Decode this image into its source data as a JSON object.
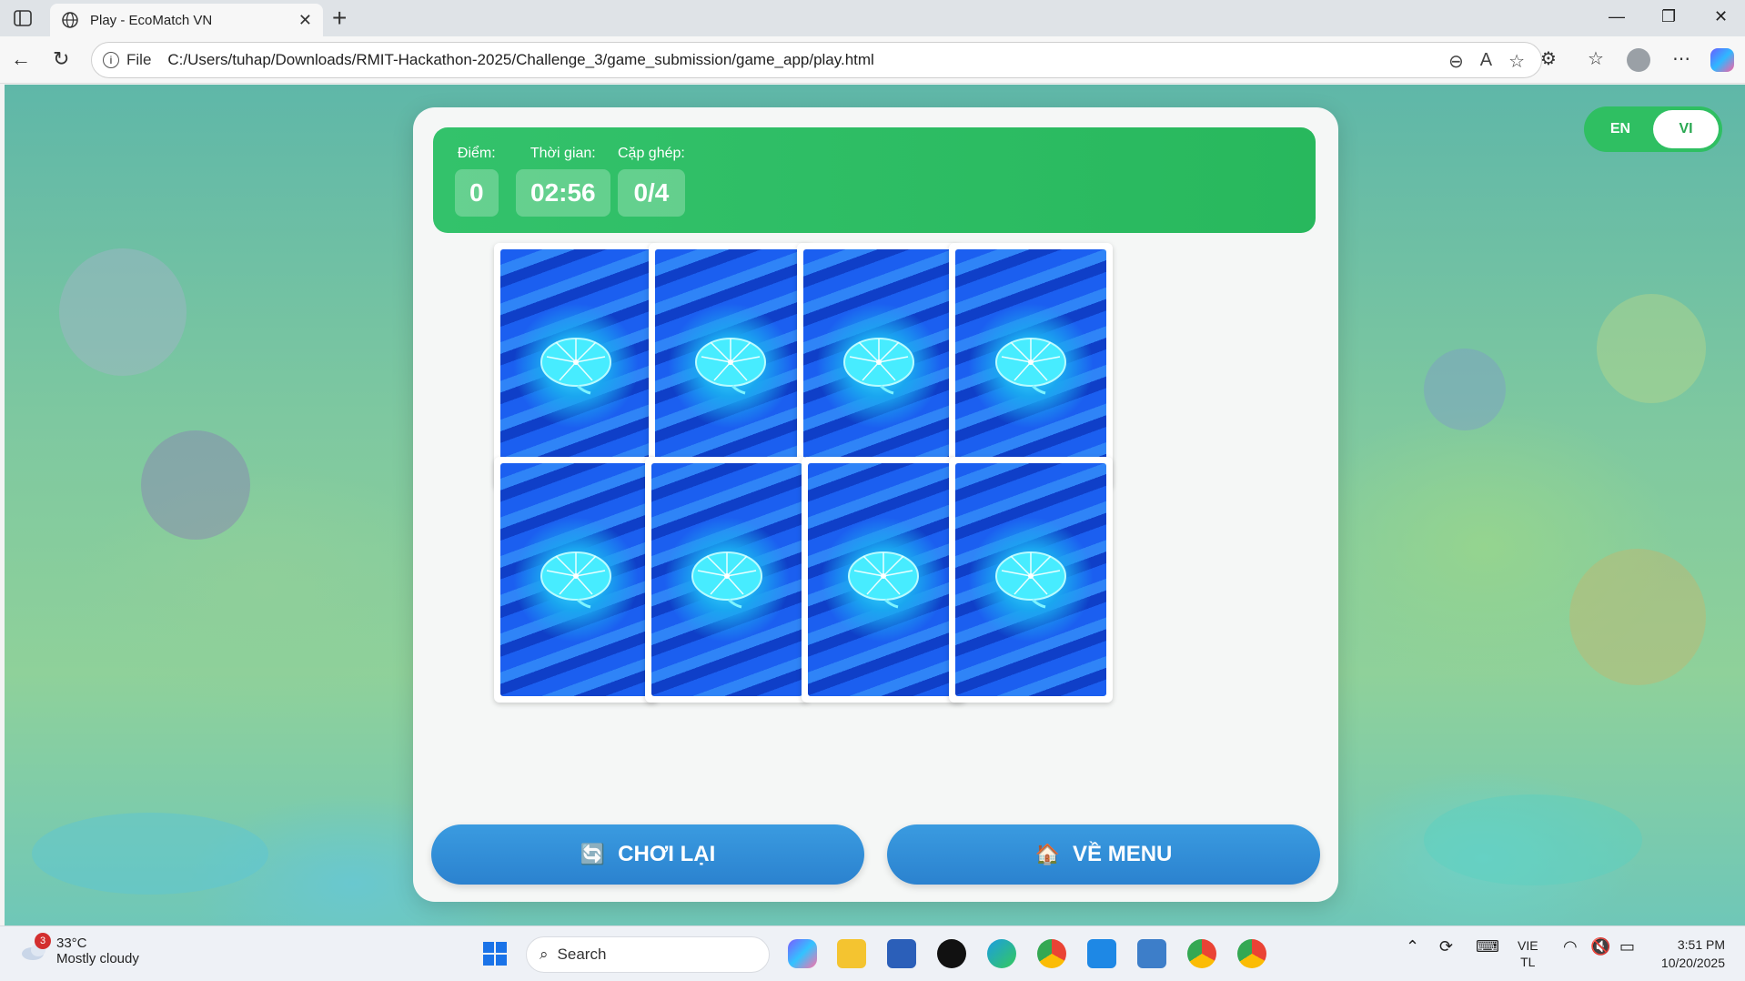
{
  "browser": {
    "tab_title": "Play - EcoMatch VN",
    "url_prefix": "File",
    "url": "C:/Users/tuhap/Downloads/RMIT-Hackathon-2025/Challenge_3/game_submission/game_app/play.html"
  },
  "lang": {
    "en": "EN",
    "vi": "VI",
    "active": "VI"
  },
  "stats": {
    "score_label": "Điểm:",
    "score_value": "0",
    "time_label": "Thời gian:",
    "time_value": "02:56",
    "pairs_label": "Cặp ghép:",
    "pairs_value": "0/4"
  },
  "cards": {
    "count": 8,
    "state": "face-down"
  },
  "buttons": {
    "replay_icon": "🔄",
    "replay_label": "CHƠI LẠI",
    "menu_icon": "🏠",
    "menu_label": "VỀ MENU"
  },
  "taskbar": {
    "weather_temp": "33°C",
    "weather_desc": "Mostly cloudy",
    "weather_badge": "3",
    "search_placeholder": "Search",
    "lang_top": "VIE",
    "lang_bottom": "TL",
    "time": "3:51 PM",
    "date": "10/20/2025"
  },
  "colors": {
    "accent_green": "#2fbf62",
    "button_blue": "#2b82cf",
    "card_blue": "#1b5ff0"
  }
}
